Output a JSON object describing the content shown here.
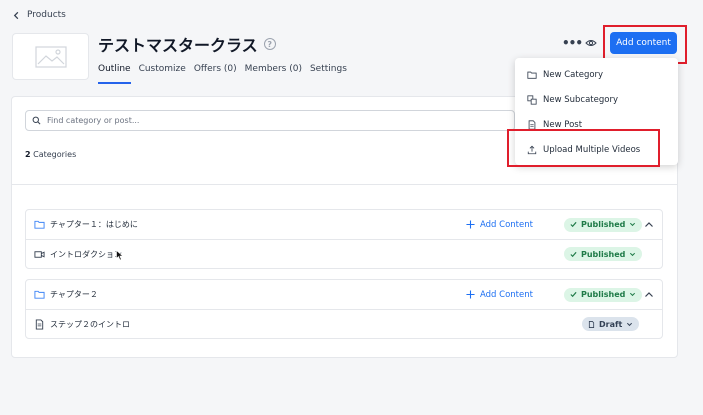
{
  "nav": {
    "back_label": "Products"
  },
  "product": {
    "title": "テストマスタークラス",
    "help": "?"
  },
  "tabs": [
    {
      "label": "Outline"
    },
    {
      "label": "Customize"
    },
    {
      "label": "Offers (0)"
    },
    {
      "label": "Members (0)"
    },
    {
      "label": "Settings"
    }
  ],
  "toolbar": {
    "more": "•••",
    "add_content_label": "Add content"
  },
  "dropdown": {
    "items": [
      {
        "label": "New Category",
        "icon": "folder-icon"
      },
      {
        "label": "New Subcategory",
        "icon": "subcategory-icon"
      },
      {
        "label": "New Post",
        "icon": "document-icon"
      },
      {
        "label": "Upload Multiple Videos",
        "icon": "upload-icon"
      }
    ]
  },
  "outline": {
    "search_placeholder": "Find category or post...",
    "count_number": "2",
    "count_label": " Categories",
    "chapters": [
      {
        "title": "チャプター１：はじめに",
        "add_label": "Add Content",
        "status": "Published",
        "posts": [
          {
            "title": "イントロダクション",
            "status": "Published",
            "icon": "video-icon"
          }
        ]
      },
      {
        "title": "チャプター２",
        "add_label": "Add Content",
        "status": "Published",
        "posts": [
          {
            "title": "ステップ２のイントロ",
            "status": "Draft",
            "icon": "document-icon"
          }
        ]
      }
    ]
  },
  "colors": {
    "accent": "#1d6ff2",
    "published_bg": "#dcf5e6",
    "published_text": "#1e7a47",
    "draft_bg": "#dbe3ec",
    "highlight": "#e01e2c"
  }
}
